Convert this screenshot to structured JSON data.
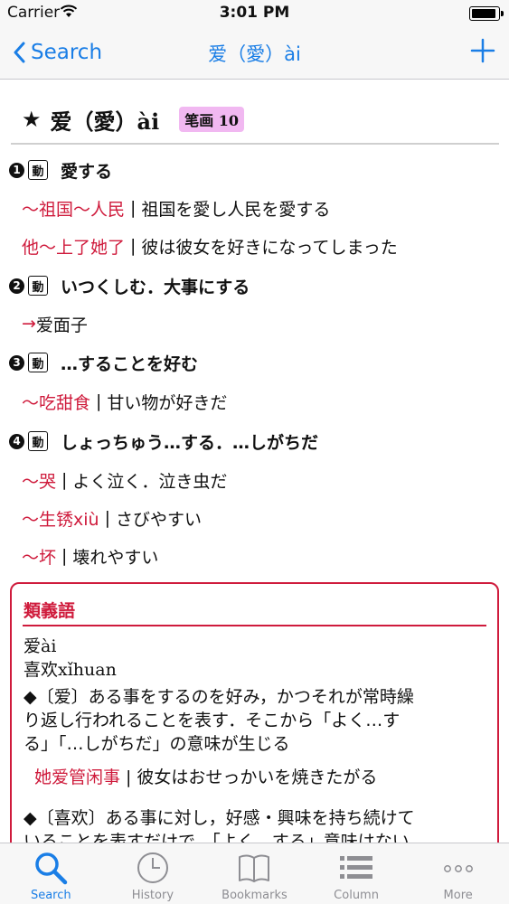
{
  "status": {
    "carrier": "Carrier",
    "time": "3:01 PM",
    "battery_level": 1.0
  },
  "nav": {
    "back_label": "Search",
    "title": "爱（愛）ài"
  },
  "entry": {
    "headword": "爱（愛）ài",
    "stroke_badge": "笔画 10",
    "senses": [
      {
        "num": "1",
        "pos": "動",
        "gloss": "愛する",
        "examples": [
          {
            "zh": "～祖国～人民",
            "ja": "祖国を愛し人民を愛する"
          },
          {
            "zh": "他～上了她了",
            "ja": "彼は彼女を好きになってしまった"
          }
        ]
      },
      {
        "num": "2",
        "pos": "動",
        "gloss": "いつくしむ．大事にする",
        "cross_ref": {
          "arrow": "→",
          "text": "爱面子"
        }
      },
      {
        "num": "3",
        "pos": "動",
        "gloss": "…することを好む",
        "examples": [
          {
            "zh": "～吃甜食",
            "ja": "甘い物が好きだ"
          }
        ]
      },
      {
        "num": "4",
        "pos": "動",
        "gloss": "しょっちゅう…する．…しがちだ",
        "examples": [
          {
            "zh": "～哭",
            "ja": "よく泣く．泣き虫だ"
          },
          {
            "zh": "～生锈xiù",
            "ja": "さびやすい"
          },
          {
            "zh": "～坏",
            "ja": "壊れやすい"
          }
        ]
      }
    ],
    "separator": "|"
  },
  "synonyms": {
    "title": "類義語",
    "words": [
      "爱ài",
      "喜欢xǐhuan"
    ],
    "para1": [
      "◆〔爱〕ある事をするのを好み，かつそれが常時繰",
      "り返し行われることを表す．そこから「よく…す",
      "る」「…しがちだ」の意味が生じる"
    ],
    "example": {
      "zh": "她爱管闲事",
      "ja": "彼女はおせっかいを焼きたがる"
    },
    "para2": [
      "◆〔喜欢〕ある事に対し，好感・興味を持ち続けて",
      "いることを表すだけで，「よく…する」意味はない"
    ]
  },
  "tabs": [
    {
      "label": "Search",
      "icon": "search-icon",
      "active": true
    },
    {
      "label": "History",
      "icon": "clock-icon",
      "active": false
    },
    {
      "label": "Bookmarks",
      "icon": "book-icon",
      "active": false
    },
    {
      "label": "Column",
      "icon": "list-icon",
      "active": false
    },
    {
      "label": "More",
      "icon": "more-icon",
      "active": false
    }
  ],
  "colors": {
    "accent": "#1a7ee6",
    "red": "#cf1b3c",
    "badge_bg": "#f1b8f1",
    "inactive": "#8e8e93"
  }
}
